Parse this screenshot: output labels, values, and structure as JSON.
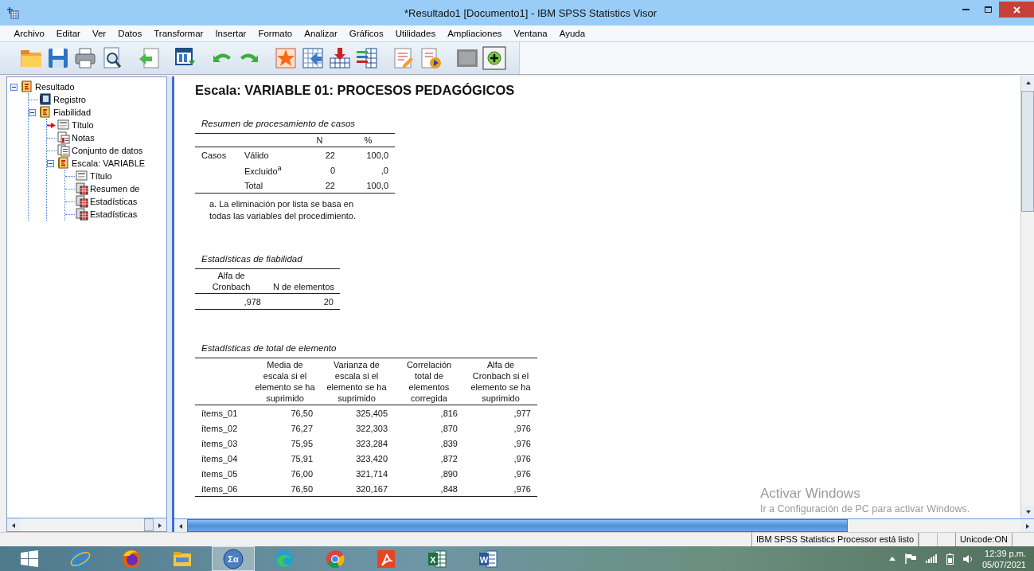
{
  "window": {
    "title": "*Resultado1 [Documento1] - IBM SPSS Statistics Visor"
  },
  "menu": [
    "Archivo",
    "Editar",
    "Ver",
    "Datos",
    "Transformar",
    "Insertar",
    "Formato",
    "Analizar",
    "Gráficos",
    "Utilidades",
    "Ampliaciones",
    "Ventana",
    "Ayuda"
  ],
  "outline": {
    "items": [
      {
        "label": "Resultado",
        "kind": "book",
        "current": false,
        "expanded": true,
        "children": [
          {
            "label": "Registro",
            "kind": "log",
            "current": false
          },
          {
            "label": "Fiabilidad",
            "kind": "book",
            "current": false,
            "expanded": true,
            "children": [
              {
                "label": "Título",
                "kind": "title",
                "current": true
              },
              {
                "label": "Notas",
                "kind": "notes",
                "current": false
              },
              {
                "label": "Conjunto de datos",
                "kind": "dataset",
                "current": false
              },
              {
                "label": "Escala: VARIABLE",
                "kind": "book",
                "current": false,
                "expanded": true,
                "children": [
                  {
                    "label": "Título",
                    "kind": "title",
                    "current": false
                  },
                  {
                    "label": "Resumen de",
                    "kind": "table",
                    "current": false
                  },
                  {
                    "label": "Estadísticas",
                    "kind": "table",
                    "current": false
                  },
                  {
                    "label": "Estadísticas",
                    "kind": "table",
                    "current": false
                  }
                ]
              }
            ]
          }
        ]
      }
    ]
  },
  "output": {
    "heading": "Escala: VARIABLE 01: PROCESOS PEDAGÓGICOS",
    "tables": [
      {
        "kind": "summary",
        "title": "Resumen de procesamiento de casos",
        "columns": [
          "N",
          "%"
        ],
        "rows": [
          {
            "group": "Casos",
            "label": "Válido",
            "cells": [
              "22",
              "100,0"
            ]
          },
          {
            "label": "Excluido$^{a}$",
            "cells": [
              "0",
              ",0"
            ]
          },
          {
            "label": "Total",
            "cells": [
              "22",
              "100,0"
            ]
          }
        ],
        "footnote": "a. La eliminación por lista se basa en todas las variables del procedimiento."
      },
      {
        "kind": "reliability",
        "title": "Estadísticas de fiabilidad",
        "columns": [
          "Alfa de Cronbach",
          "N de elementos"
        ],
        "rows": [
          {
            "cells": [
              ",978",
              "20"
            ]
          }
        ]
      },
      {
        "kind": "item_total",
        "title": "Estadísticas de total de elemento",
        "columns": [
          "Media de escala si el elemento se ha suprimido",
          "Varianza de escala si el elemento se ha suprimido",
          "Correlación total de elementos corregida",
          "Alfa de Cronbach si el elemento se ha suprimido"
        ],
        "rows": [
          {
            "label": "ítems_01",
            "cells": [
              "76,50",
              "325,405",
              ",816",
              ",977"
            ]
          },
          {
            "label": "ítems_02",
            "cells": [
              "76,27",
              "322,303",
              ",870",
              ",976"
            ]
          },
          {
            "label": "ítems_03",
            "cells": [
              "75,95",
              "323,284",
              ",839",
              ",976"
            ]
          },
          {
            "label": "ítems_04",
            "cells": [
              "75,91",
              "323,420",
              ",872",
              ",976"
            ]
          },
          {
            "label": "ítems_05",
            "cells": [
              "76,00",
              "321,714",
              ",890",
              ",976"
            ]
          },
          {
            "label": "ítems_06",
            "cells": [
              "76,50",
              "320,167",
              ",848",
              ",976"
            ]
          }
        ]
      }
    ]
  },
  "activation_notice": {
    "title": "Activar Windows",
    "text": "Ir a Configuración de PC para activar Windows."
  },
  "status_bar": {
    "message": "IBM SPSS Statistics Processor está listo",
    "encoding": "Unicode:ON"
  },
  "taskbar": {
    "buttons": [
      {
        "kind": "start",
        "selected": false
      },
      {
        "kind": "ie",
        "selected": false
      },
      {
        "kind": "firefox",
        "selected": false
      },
      {
        "kind": "explorer",
        "selected": false
      },
      {
        "kind": "spss",
        "glyph": "Σα",
        "selected": true
      },
      {
        "kind": "edge",
        "selected": false
      },
      {
        "kind": "chrome",
        "selected": false
      },
      {
        "kind": "pdf",
        "selected": false
      },
      {
        "kind": "excel",
        "glyph": "X",
        "selected": false
      },
      {
        "kind": "word",
        "glyph": "W",
        "selected": false
      }
    ],
    "time": "12:39 p.m.",
    "date": "05/07/2021"
  }
}
